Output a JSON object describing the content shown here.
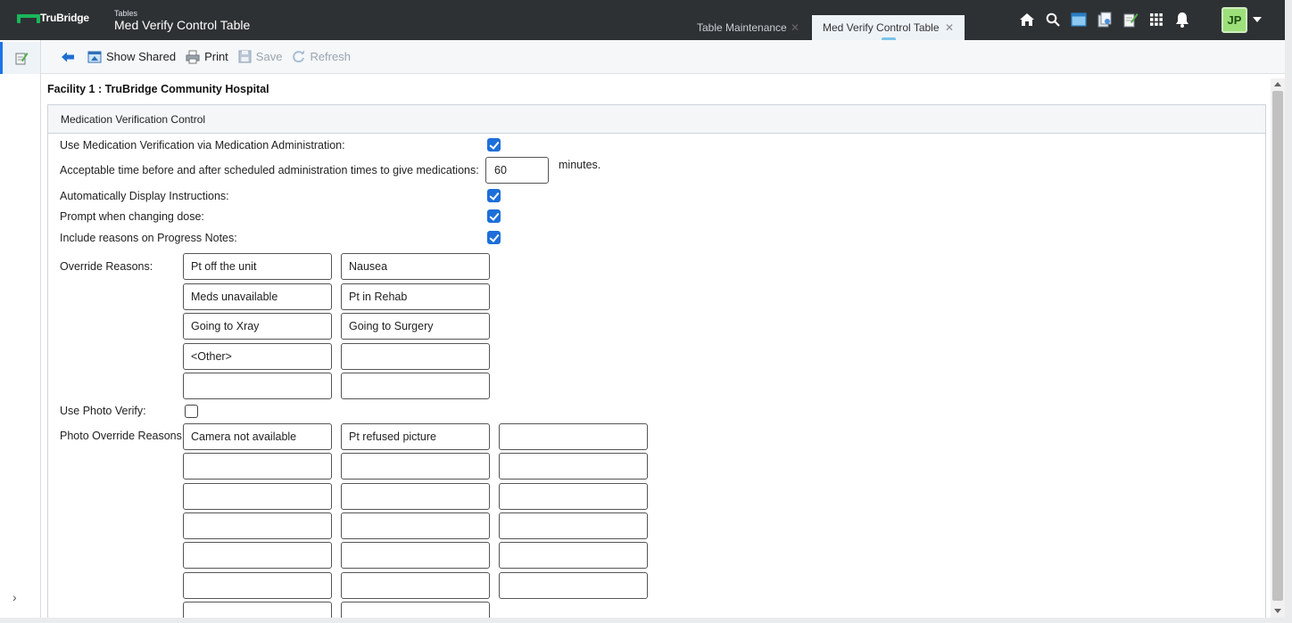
{
  "app": {
    "brand": "TruBridge",
    "section": "Tables",
    "title": "Med Verify Control Table"
  },
  "tabs": [
    {
      "label": "Table Maintenance",
      "active": false
    },
    {
      "label": "Med Verify Control Table",
      "active": true
    }
  ],
  "top_icons": [
    "home-icon",
    "search-icon",
    "window-icon",
    "documents-icon",
    "notes-icon",
    "apps-grid-icon",
    "bell-icon"
  ],
  "user": {
    "initials": "JP"
  },
  "toolbar": {
    "show_shared": "Show Shared",
    "print": "Print",
    "save": "Save",
    "refresh": "Refresh"
  },
  "facility": "Facility 1 : TruBridge Community Hospital",
  "panel": {
    "title": "Medication Verification Control",
    "use_med_verification": {
      "label": "Use Medication Verification via Medication Administration:",
      "checked": true
    },
    "acceptable_time": {
      "label": "Acceptable time before and after scheduled administration times to give medications:",
      "value": "60",
      "unit": "minutes."
    },
    "auto_display_instructions": {
      "label": "Automatically Display Instructions:",
      "checked": true
    },
    "prompt_changing_dose": {
      "label": "Prompt when changing dose:",
      "checked": true
    },
    "include_reasons_progress": {
      "label": "Include reasons on Progress Notes:",
      "checked": true
    },
    "override_reasons": {
      "label": "Override Reasons:",
      "values": [
        [
          "Pt off the unit",
          "Nausea"
        ],
        [
          "Meds unavailable",
          "Pt in Rehab"
        ],
        [
          "Going to Xray",
          "Going to Surgery"
        ],
        [
          "<Other>",
          ""
        ],
        [
          "",
          ""
        ]
      ]
    },
    "use_photo_verify": {
      "label": "Use Photo Verify:",
      "checked": false
    },
    "photo_override_reasons": {
      "label": "Photo Override Reasons:",
      "values": [
        [
          "Camera not available",
          "Pt refused picture",
          ""
        ],
        [
          "",
          "",
          ""
        ],
        [
          "",
          "",
          ""
        ],
        [
          "",
          "",
          ""
        ],
        [
          "",
          "",
          ""
        ],
        [
          "",
          "",
          ""
        ],
        [
          "",
          "",
          ""
        ]
      ]
    }
  },
  "colors": {
    "topbar": "#2e3134",
    "accent": "#1e6fd9",
    "brand_green": "#19b65a",
    "avatar": "#9de07a"
  }
}
